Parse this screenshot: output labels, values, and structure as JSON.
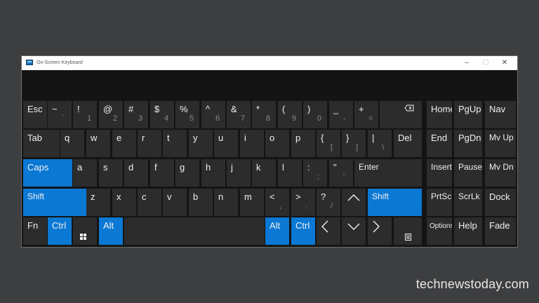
{
  "window": {
    "title": "On-Screen Keyboard",
    "controls": {
      "minimize": "–",
      "maximize": "☐",
      "close": "✕"
    }
  },
  "rows": [
    [
      {
        "id": "esc",
        "label": "Esc"
      },
      {
        "id": "tilde",
        "label": "~",
        "sub": "`"
      },
      {
        "id": "1",
        "label": "!",
        "sub": "1"
      },
      {
        "id": "2",
        "label": "@",
        "sub": "2"
      },
      {
        "id": "3",
        "label": "#",
        "sub": "3"
      },
      {
        "id": "4",
        "label": "$",
        "sub": "4"
      },
      {
        "id": "5",
        "label": "%",
        "sub": "5"
      },
      {
        "id": "6",
        "label": "^",
        "sub": "6"
      },
      {
        "id": "7",
        "label": "&",
        "sub": "7"
      },
      {
        "id": "8",
        "label": "*",
        "sub": "8"
      },
      {
        "id": "9",
        "label": "(",
        "sub": "9"
      },
      {
        "id": "0",
        "label": ")",
        "sub": "0"
      },
      {
        "id": "minus",
        "label": "_",
        "sub": "-"
      },
      {
        "id": "plus",
        "label": "+",
        "sub": "="
      },
      {
        "id": "backspace",
        "icon": "backspace-icon"
      },
      {
        "id": "home",
        "label": "Home"
      },
      {
        "id": "pgup",
        "label": "PgUp"
      },
      {
        "id": "nav",
        "label": "Nav"
      }
    ],
    [
      {
        "id": "tab",
        "label": "Tab"
      },
      {
        "id": "q",
        "label": "q"
      },
      {
        "id": "w",
        "label": "w"
      },
      {
        "id": "e",
        "label": "e"
      },
      {
        "id": "r",
        "label": "r"
      },
      {
        "id": "t",
        "label": "t"
      },
      {
        "id": "y",
        "label": "y"
      },
      {
        "id": "u",
        "label": "u"
      },
      {
        "id": "i",
        "label": "i"
      },
      {
        "id": "o",
        "label": "o"
      },
      {
        "id": "p",
        "label": "p"
      },
      {
        "id": "lbrace",
        "label": "{",
        "sub": "["
      },
      {
        "id": "rbrace",
        "label": "}",
        "sub": "]"
      },
      {
        "id": "pipe",
        "label": "|",
        "sub": "\\"
      },
      {
        "id": "del",
        "label": "Del"
      },
      {
        "id": "end",
        "label": "End"
      },
      {
        "id": "pgdn",
        "label": "PgDn"
      },
      {
        "id": "mvup",
        "label": "Mv Up"
      }
    ],
    [
      {
        "id": "caps",
        "label": "Caps"
      },
      {
        "id": "a",
        "label": "a"
      },
      {
        "id": "s",
        "label": "s"
      },
      {
        "id": "d",
        "label": "d"
      },
      {
        "id": "f",
        "label": "f"
      },
      {
        "id": "g",
        "label": "g"
      },
      {
        "id": "h",
        "label": "h"
      },
      {
        "id": "j",
        "label": "j"
      },
      {
        "id": "k",
        "label": "k"
      },
      {
        "id": "l",
        "label": "l"
      },
      {
        "id": "colon",
        "label": ":",
        "sub": ";"
      },
      {
        "id": "quote",
        "label": "\"",
        "sub": "'"
      },
      {
        "id": "enter",
        "label": "Enter"
      },
      {
        "id": "insert",
        "label": "Insert"
      },
      {
        "id": "pause",
        "label": "Pause"
      },
      {
        "id": "mvdn",
        "label": "Mv Dn"
      }
    ],
    [
      {
        "id": "lshift",
        "label": "Shift"
      },
      {
        "id": "z",
        "label": "z"
      },
      {
        "id": "x",
        "label": "x"
      },
      {
        "id": "c",
        "label": "c"
      },
      {
        "id": "v",
        "label": "v"
      },
      {
        "id": "b",
        "label": "b"
      },
      {
        "id": "n",
        "label": "n"
      },
      {
        "id": "m",
        "label": "m"
      },
      {
        "id": "lt",
        "label": "<",
        "sub": ","
      },
      {
        "id": "gt",
        "label": ">",
        "sub": "."
      },
      {
        "id": "question",
        "label": "?",
        "sub": "/"
      },
      {
        "id": "up",
        "icon": "arrow-up-icon"
      },
      {
        "id": "rshift",
        "label": "Shift"
      },
      {
        "id": "prtscn",
        "label": "PrtScn"
      },
      {
        "id": "scrlk",
        "label": "ScrLk"
      },
      {
        "id": "dock",
        "label": "Dock"
      }
    ],
    [
      {
        "id": "fn",
        "label": "Fn"
      },
      {
        "id": "lctrl",
        "label": "Ctrl"
      },
      {
        "id": "win",
        "icon": "windows-icon"
      },
      {
        "id": "lalt",
        "label": "Alt"
      },
      {
        "id": "space",
        "label": ""
      },
      {
        "id": "ralt",
        "label": "Alt"
      },
      {
        "id": "rctrl",
        "label": "Ctrl"
      },
      {
        "id": "left",
        "icon": "arrow-left-icon"
      },
      {
        "id": "down",
        "icon": "arrow-down-icon"
      },
      {
        "id": "right",
        "icon": "arrow-right-icon"
      },
      {
        "id": "menu",
        "icon": "context-menu-icon"
      },
      {
        "id": "options",
        "label": "Options"
      },
      {
        "id": "help",
        "label": "Help"
      },
      {
        "id": "fade",
        "label": "Fade"
      }
    ]
  ],
  "active_keys": [
    "caps",
    "lshift",
    "rshift",
    "lctrl",
    "lalt",
    "ralt",
    "rctrl"
  ],
  "colors": {
    "active": "#0b78d4",
    "key": "#2c2c2c",
    "background": "#3d3e40"
  },
  "watermark": "technewstoday.com"
}
